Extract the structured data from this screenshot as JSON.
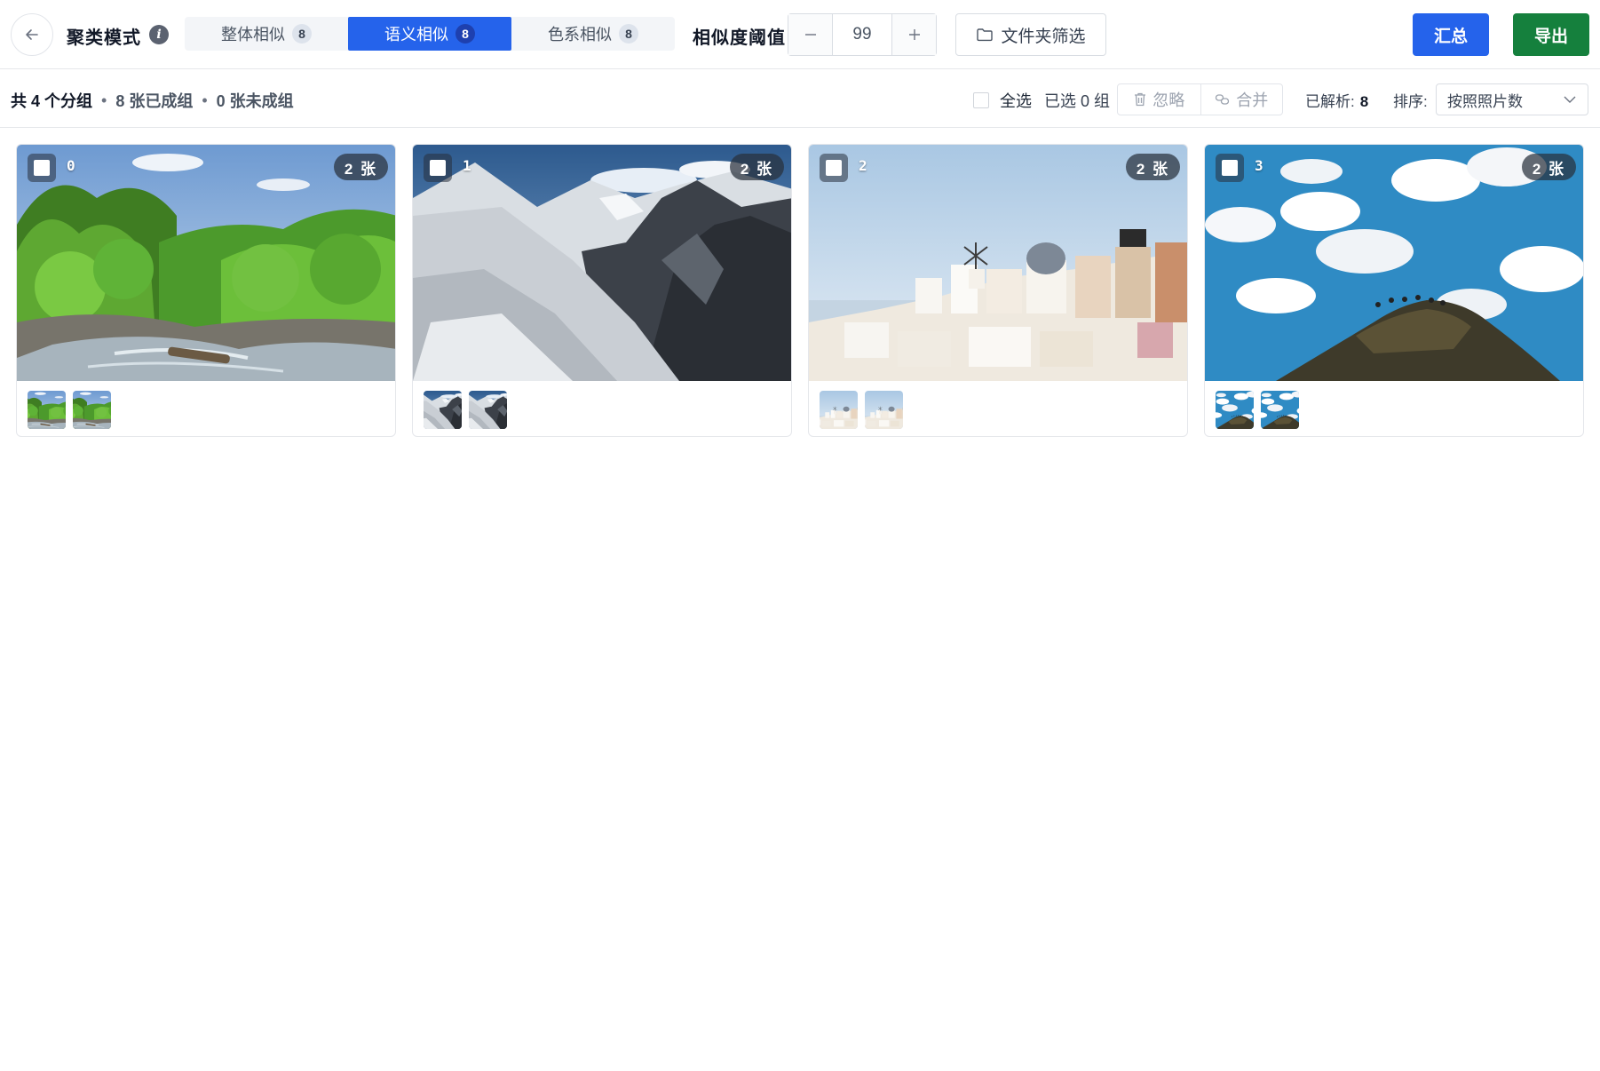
{
  "toolbar": {
    "mode_title": "聚类模式",
    "info_icon": "info-icon",
    "tabs": [
      {
        "label": "整体相似",
        "count": "8"
      },
      {
        "label": "语义相似",
        "count": "8"
      },
      {
        "label": "色系相似",
        "count": "8"
      }
    ],
    "active_tab_index": 1,
    "threshold_label": "相似度阈值",
    "threshold_value": "99",
    "folder_filter_label": "文件夹筛选",
    "summary_label": "汇总",
    "export_label": "导出",
    "colors": {
      "primary": "#2563eb",
      "export": "#15803d"
    }
  },
  "subbar": {
    "groups_text": "共 4 个分组",
    "grouped_text": "8 张已成组",
    "ungrouped_text": "0 张未成组",
    "dot": "•",
    "select_all_label": "全选",
    "selected_text": "已选 0 组",
    "ignore_label": "忽略",
    "merge_label": "合并",
    "parsed_label": "已解析:",
    "parsed_value": "8",
    "sort_label": "排序:",
    "sort_value": "按照照片数"
  },
  "groups": [
    {
      "index": "0",
      "badge": "2 张",
      "scene": "forest-stream"
    },
    {
      "index": "1",
      "badge": "2 张",
      "scene": "snowy-mountains"
    },
    {
      "index": "2",
      "badge": "2 张",
      "scene": "santorini-village"
    },
    {
      "index": "3",
      "badge": "2 张",
      "scene": "cloudy-sky-summit"
    }
  ]
}
